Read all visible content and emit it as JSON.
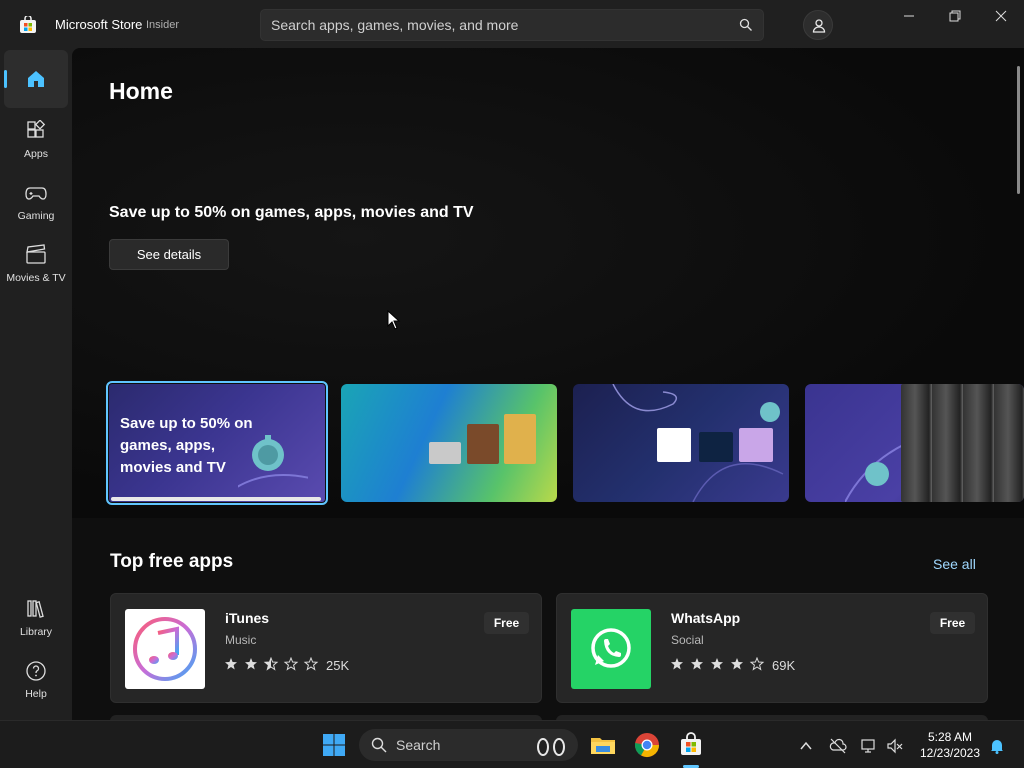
{
  "window": {
    "title": "Microsoft Store",
    "badge": "Insider",
    "search_placeholder": "Search apps, games, movies, and more"
  },
  "sidebar": {
    "items": [
      {
        "label": "Home",
        "icon": "home-icon"
      },
      {
        "label": "Apps",
        "icon": "apps-icon"
      },
      {
        "label": "Gaming",
        "icon": "gamepad-icon"
      },
      {
        "label": "Movies & TV",
        "icon": "clapperboard-icon"
      }
    ],
    "bottom": [
      {
        "label": "Library",
        "icon": "library-icon"
      },
      {
        "label": "Help",
        "icon": "help-icon"
      }
    ]
  },
  "main": {
    "page_title": "Home",
    "hero": {
      "headline": "Save up to 50% on games, apps, movies and TV",
      "button": "See details"
    },
    "carousel": [
      {
        "text": "Save up to 50% on games, apps, movies and TV"
      },
      {
        "text": ""
      },
      {
        "text": ""
      },
      {
        "text": ""
      }
    ],
    "section": {
      "title": "Top free apps",
      "see_all": "See all"
    },
    "apps": [
      {
        "name": "iTunes",
        "category": "Music",
        "price": "Free",
        "rating": 2.5,
        "ratings_count": "25K"
      },
      {
        "name": "WhatsApp",
        "category": "Social",
        "price": "Free",
        "rating": 4,
        "ratings_count": "69K"
      }
    ]
  },
  "taskbar": {
    "search_label": "Search",
    "time": "5:28 AM",
    "date": "12/23/2023"
  },
  "colors": {
    "accent": "#60c6ff",
    "whatsapp_green": "#25d366"
  }
}
